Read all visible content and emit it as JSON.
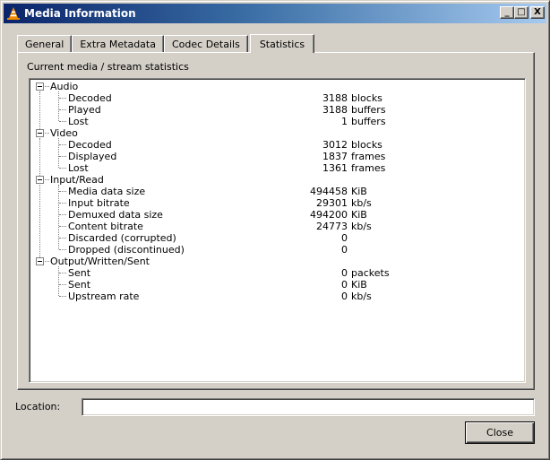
{
  "window": {
    "title": "Media Information",
    "icon": "vlc-cone-icon",
    "controls": {
      "minimize": "_",
      "maximize": "□",
      "close": "X"
    }
  },
  "tabs": [
    {
      "label": "General",
      "active": false
    },
    {
      "label": "Extra Metadata",
      "active": false
    },
    {
      "label": "Codec Details",
      "active": false
    },
    {
      "label": "Statistics",
      "active": true
    }
  ],
  "panel": {
    "heading": "Current media / stream statistics",
    "groups": [
      {
        "label": "Audio",
        "items": [
          {
            "label": "Decoded",
            "value": "3188",
            "unit": "blocks"
          },
          {
            "label": "Played",
            "value": "3188",
            "unit": "buffers"
          },
          {
            "label": "Lost",
            "value": "1",
            "unit": "buffers"
          }
        ]
      },
      {
        "label": "Video",
        "items": [
          {
            "label": "Decoded",
            "value": "3012",
            "unit": "blocks"
          },
          {
            "label": "Displayed",
            "value": "1837",
            "unit": "frames"
          },
          {
            "label": "Lost",
            "value": "1361",
            "unit": "frames"
          }
        ]
      },
      {
        "label": "Input/Read",
        "items": [
          {
            "label": "Media data size",
            "value": "494458",
            "unit": "KiB"
          },
          {
            "label": "Input bitrate",
            "value": "29301",
            "unit": "kb/s"
          },
          {
            "label": "Demuxed data size",
            "value": "494200",
            "unit": "KiB"
          },
          {
            "label": "Content bitrate",
            "value": "24773",
            "unit": "kb/s"
          },
          {
            "label": "Discarded (corrupted)",
            "value": "0",
            "unit": ""
          },
          {
            "label": "Dropped (discontinued)",
            "value": "0",
            "unit": ""
          }
        ]
      },
      {
        "label": "Output/Written/Sent",
        "items": [
          {
            "label": "Sent",
            "value": "0",
            "unit": "packets"
          },
          {
            "label": "Sent",
            "value": "0",
            "unit": "KiB"
          },
          {
            "label": "Upstream rate",
            "value": "0",
            "unit": "kb/s"
          }
        ]
      }
    ]
  },
  "location": {
    "label": "Location:",
    "value": ""
  },
  "buttons": {
    "close": "Close"
  }
}
